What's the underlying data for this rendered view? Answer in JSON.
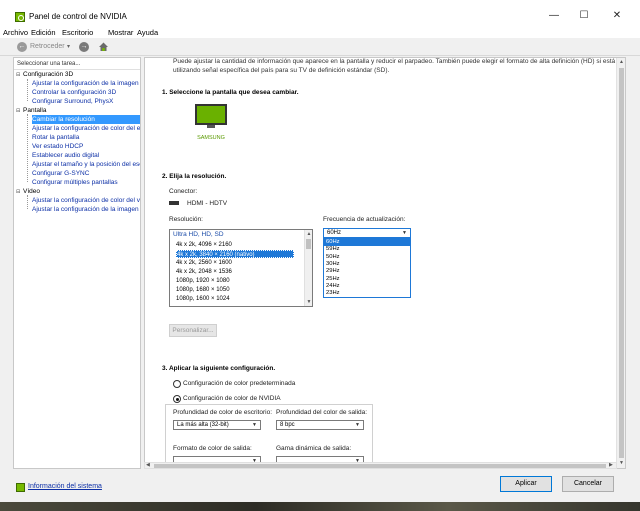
{
  "window": {
    "title": "Panel de control de NVIDIA"
  },
  "menu": [
    "Archivo",
    "Edición",
    "Escritorio",
    "Mostrar",
    "Ayuda"
  ],
  "toolbar": {
    "back_label": "Retroceder"
  },
  "sidebar": {
    "header": "Seleccionar una tarea...",
    "tree": [
      {
        "kind": "cat",
        "label": "Configuración 3D"
      },
      {
        "kind": "child",
        "label": "Ajustar la configuración de la imagen con vista previa"
      },
      {
        "kind": "child",
        "label": "Controlar la configuración 3D"
      },
      {
        "kind": "child",
        "label": "Configurar Surround, PhysX"
      },
      {
        "kind": "cat",
        "label": "Pantalla"
      },
      {
        "kind": "child",
        "label": "Cambiar la resolución",
        "selected": true
      },
      {
        "kind": "child",
        "label": "Ajustar la configuración de color del escritorio"
      },
      {
        "kind": "child",
        "label": "Rotar la pantalla"
      },
      {
        "kind": "child",
        "label": "Ver estado HDCP"
      },
      {
        "kind": "child",
        "label": "Establecer audio digital"
      },
      {
        "kind": "child",
        "label": "Ajustar el tamaño y la posición del escritorio"
      },
      {
        "kind": "child",
        "label": "Configurar G-SYNC"
      },
      {
        "kind": "child",
        "label": "Configurar múltiples pantallas"
      },
      {
        "kind": "cat",
        "label": "Vídeo"
      },
      {
        "kind": "child",
        "label": "Ajustar la configuración de color del vídeo"
      },
      {
        "kind": "child",
        "label": "Ajustar la configuración de la imagen de vídeo"
      }
    ],
    "system_info": "Información del sistema"
  },
  "content": {
    "intro": "Puede ajustar la cantidad de información que aparece en la pantalla y reducir el parpadeo. También puede elegir el formato de alta definición (HD) si está utilizando señal específica del país para su TV de definición estándar (SD).",
    "step1": "1. Seleccione la pantalla que desea cambiar.",
    "monitor_label": "SAMSUNG",
    "step2": "2. Elija la resolución.",
    "connector_label": "Conector:",
    "connector_value": "HDMI - HDTV",
    "resolution_label": "Resolución:",
    "refresh_label": "Frecuencia de actualización:",
    "resolutions": [
      {
        "label": "Ultra HD, HD, SD",
        "group": true
      },
      {
        "label": "4k x 2k, 4096 × 2160"
      },
      {
        "label": "4k x 2k, 3840 × 2160 (nativo)",
        "selected": true
      },
      {
        "label": "4k x 2k, 2560 × 1600"
      },
      {
        "label": "4k x 2k, 2048 × 1536"
      },
      {
        "label": "1080p, 1920 × 1080"
      },
      {
        "label": "1080p, 1680 × 1050"
      },
      {
        "label": "1080p, 1600 × 1024"
      }
    ],
    "refresh_current": "60Hz",
    "refresh_options": [
      {
        "label": "60Hz",
        "selected": true
      },
      {
        "label": "59Hz"
      },
      {
        "label": "50Hz"
      },
      {
        "label": "30Hz"
      },
      {
        "label": "29Hz"
      },
      {
        "label": "25Hz"
      },
      {
        "label": "24Hz"
      },
      {
        "label": "23Hz"
      }
    ],
    "customize_button": "Personalizar...",
    "step3": "3. Aplicar la siguiente configuración.",
    "radio_default": "Configuración de color predeterminada",
    "radio_nvidia": "Configuración de color de NVIDIA",
    "desktop_depth_label": "Profundidad de color de escritorio:",
    "desktop_depth_value": "La más alta (32-bit)",
    "output_depth_label": "Profundidad del color de salida:",
    "output_depth_value": "8 bpc",
    "output_format_label": "Formato de color de salida:",
    "dynamic_range_label": "Gama dinámica de salida:"
  },
  "footer": {
    "apply": "Aplicar",
    "cancel": "Cancelar"
  },
  "colors": {
    "accent": "#1e78d7",
    "nvidia_green": "#76b900",
    "link": "#0c2fa6"
  }
}
